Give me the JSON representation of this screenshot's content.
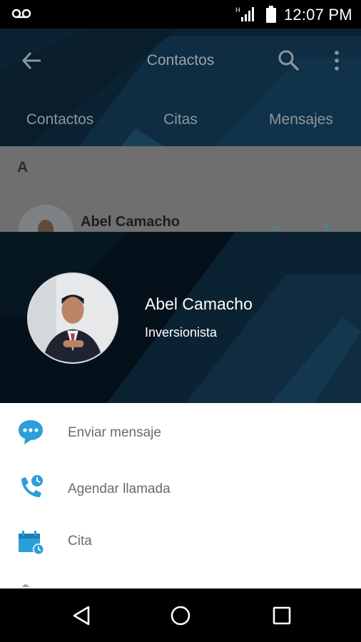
{
  "status_bar": {
    "time": "12:07 PM",
    "network_label": "H",
    "icons": [
      "voicemail-icon",
      "signal-icon",
      "battery-icon"
    ]
  },
  "app_bar": {
    "title": "Contactos",
    "icons": [
      "back-arrow-icon",
      "search-icon",
      "more-vert-icon"
    ]
  },
  "tabs": [
    {
      "label": "Contactos"
    },
    {
      "label": "Citas"
    },
    {
      "label": "Mensajes"
    }
  ],
  "contact_list": {
    "section_letter": "A",
    "items": [
      {
        "name": "Abel Camacho"
      }
    ]
  },
  "sheet": {
    "name": "Abel Camacho",
    "role": "Inversionista",
    "actions": [
      {
        "label": "Enviar mensaje",
        "icon": "chat-bubble-icon"
      },
      {
        "label": "Agendar llamada",
        "icon": "phone-clock-icon"
      },
      {
        "label": "Cita",
        "icon": "calendar-clock-icon"
      }
    ]
  },
  "colors": {
    "accent": "#2a9fd8",
    "header_bg": "#0a2031",
    "sheet_header_bg": "#05121c",
    "dim_overlay": "#6f6f6f"
  },
  "nav_bar": {
    "icons": [
      "nav-back-icon",
      "nav-home-icon",
      "nav-recents-icon"
    ]
  }
}
